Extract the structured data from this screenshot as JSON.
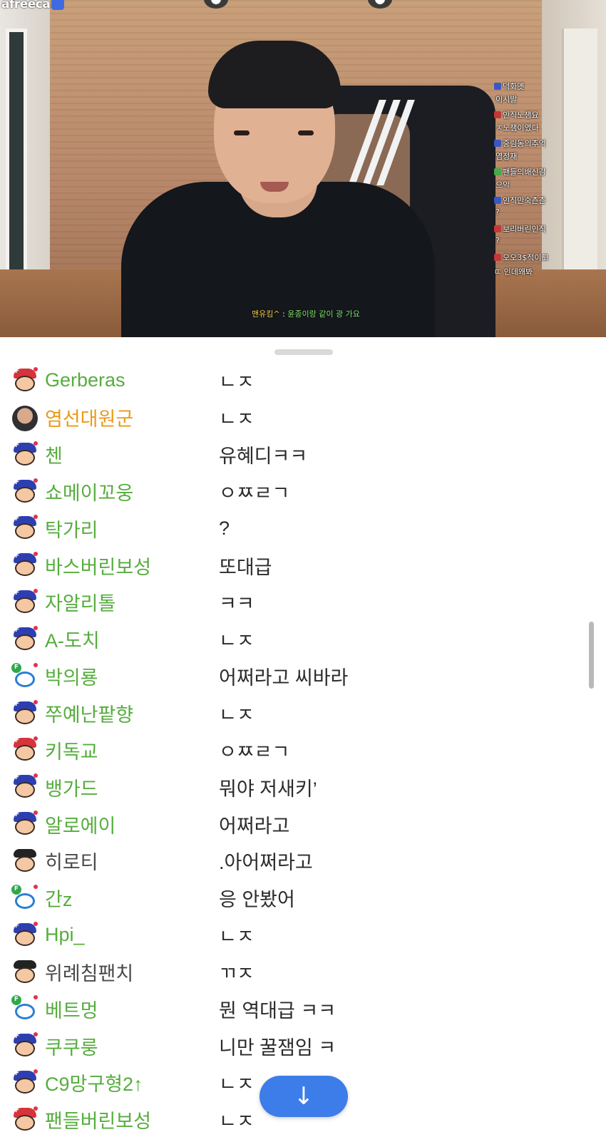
{
  "app": {
    "brand": "afreeca"
  },
  "overlay_chat": [
    {
      "user": "덕화옛",
      "message": "이시발",
      "badge": "b"
    },
    {
      "user": "인직노잼요",
      "message": "ㅈ노잼이였다",
      "badge": "r"
    },
    {
      "user": "중림동의추억",
      "message": "염정재",
      "badge": "b"
    },
    {
      "user": "팬들의배신감",
      "message": "으악",
      "badge": "g"
    },
    {
      "user": "인직만숙츤츤",
      "message": "?",
      "badge": "b"
    },
    {
      "user": "보리버린인직",
      "message": "?",
      "badge": "r"
    },
    {
      "user": "오오3$적이고",
      "message": "",
      "badge": "r"
    },
    {
      "user": "ㄸ 인데왜봐",
      "message": "",
      "badge": ""
    }
  ],
  "subtitle": {
    "user": "맨유킴^",
    "separator": " : ",
    "text": "윤종이랑 같이 광 가요"
  },
  "chat": [
    {
      "nick": "Gerberas",
      "msg": "ㄴㅈ",
      "avatar": "red",
      "color": "green"
    },
    {
      "nick": "염선대원군",
      "msg": "ㄴㅈ",
      "avatar": "photo",
      "color": "orange"
    },
    {
      "nick": "첸",
      "msg": "유혜디ㅋㅋ",
      "avatar": "blue",
      "color": "green"
    },
    {
      "nick": "쇼메이꼬웅",
      "msg": "ㅇㅉㄹㄱ",
      "avatar": "blue",
      "color": "green"
    },
    {
      "nick": "탁가리",
      "msg": "?",
      "avatar": "blue",
      "color": "green"
    },
    {
      "nick": "바스버린보성",
      "msg": "또대급",
      "avatar": "blue",
      "color": "green"
    },
    {
      "nick": "자알리톨",
      "msg": "ㅋㅋ",
      "avatar": "blue",
      "color": "green"
    },
    {
      "nick": "A-도치",
      "msg": "ㄴㅈ",
      "avatar": "blue",
      "color": "green"
    },
    {
      "nick": "박의룡",
      "msg": "어쩌라고 씨바라",
      "avatar": "panda",
      "color": "green"
    },
    {
      "nick": "쭈예난팥향",
      "msg": "ㄴㅈ",
      "avatar": "blue",
      "color": "green"
    },
    {
      "nick": "키독교",
      "msg": "ㅇㅉㄹㄱ",
      "avatar": "red",
      "color": "green"
    },
    {
      "nick": "뱅가드",
      "msg": "뭐야 저새키’",
      "avatar": "blue",
      "color": "green"
    },
    {
      "nick": "알로에이",
      "msg": "어쩌라고",
      "avatar": "blue",
      "color": "green"
    },
    {
      "nick": "히로티",
      "msg": ".아어쩌라고",
      "avatar": "plain",
      "color": "gray"
    },
    {
      "nick": "간z",
      "msg": "응 안봤어",
      "avatar": "panda",
      "color": "green"
    },
    {
      "nick": "Hpi_",
      "msg": "ㄴㅈ",
      "avatar": "blue",
      "color": "green"
    },
    {
      "nick": "위례침팬치",
      "msg": "ㄲㅈ",
      "avatar": "plain",
      "color": "gray"
    },
    {
      "nick": "베트멍",
      "msg": "뭔 역대급 ㅋㅋ",
      "avatar": "panda",
      "color": "green"
    },
    {
      "nick": "쿠쿠룽",
      "msg": "니만 꿀잼임 ㅋ",
      "avatar": "blue",
      "color": "green"
    },
    {
      "nick": "C9망구형2↑",
      "msg": "ㄴㅈ",
      "avatar": "blue",
      "color": "green"
    },
    {
      "nick": "팬들버린보성",
      "msg": "ㄴㅈ",
      "avatar": "red",
      "color": "green"
    }
  ],
  "scroll_button": {
    "icon": "arrow-down-icon",
    "glyph": "↓"
  },
  "colors": {
    "nick_green": "#56ad3e",
    "nick_orange": "#eb9a1a",
    "nick_gray": "#4a4a4a",
    "accent_blue": "#3d7de9"
  }
}
